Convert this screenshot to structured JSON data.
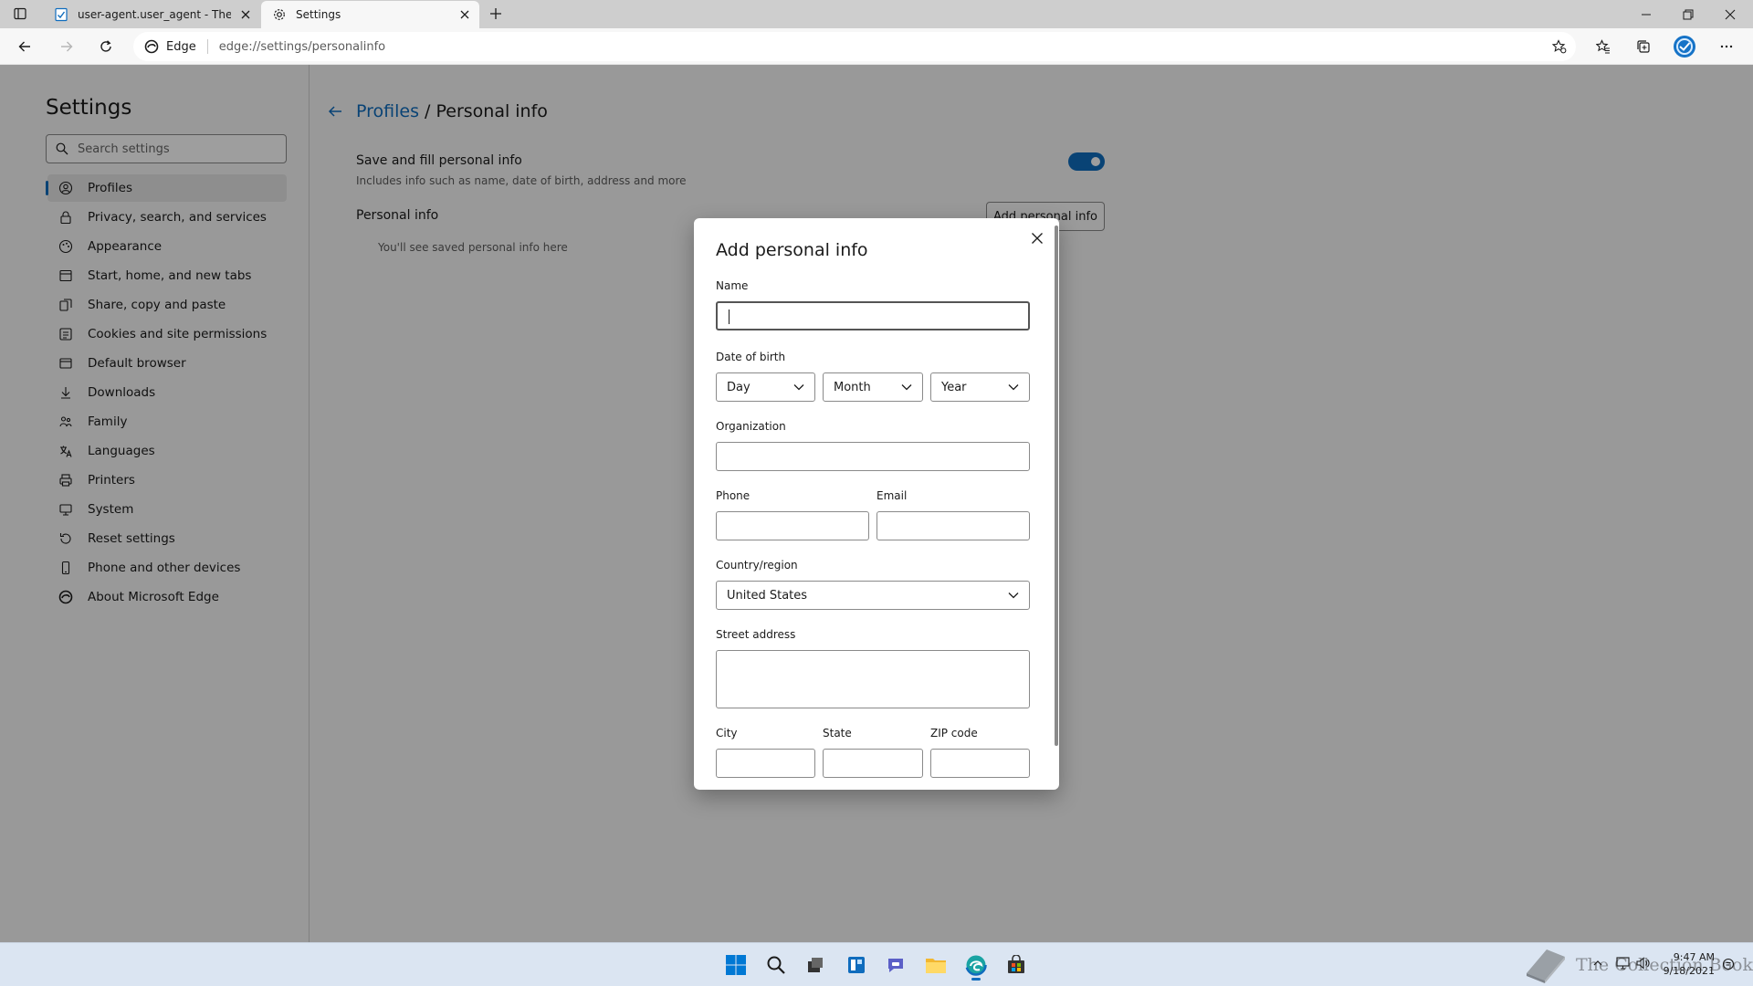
{
  "browser": {
    "tabs": [
      {
        "title": "user-agent.user_agent - The Coll",
        "icon": "document-icon"
      },
      {
        "title": "Settings",
        "icon": "gear-icon"
      }
    ],
    "address": {
      "site": "Edge",
      "url": "edge://settings/personalinfo"
    }
  },
  "sidebar": {
    "title": "Settings",
    "search_placeholder": "Search settings",
    "items": [
      {
        "label": "Profiles",
        "icon": "profile-icon"
      },
      {
        "label": "Privacy, search, and services",
        "icon": "lock-icon"
      },
      {
        "label": "Appearance",
        "icon": "appearance-icon"
      },
      {
        "label": "Start, home, and new tabs",
        "icon": "home-icon"
      },
      {
        "label": "Share, copy and paste",
        "icon": "share-icon"
      },
      {
        "label": "Cookies and site permissions",
        "icon": "cookie-icon"
      },
      {
        "label": "Default browser",
        "icon": "browser-icon"
      },
      {
        "label": "Downloads",
        "icon": "download-icon"
      },
      {
        "label": "Family",
        "icon": "family-icon"
      },
      {
        "label": "Languages",
        "icon": "language-icon"
      },
      {
        "label": "Printers",
        "icon": "printer-icon"
      },
      {
        "label": "System",
        "icon": "system-icon"
      },
      {
        "label": "Reset settings",
        "icon": "reset-icon"
      },
      {
        "label": "Phone and other devices",
        "icon": "phone-icon"
      },
      {
        "label": "About Microsoft Edge",
        "icon": "edge-icon"
      }
    ]
  },
  "main": {
    "breadcrumb_link": "Profiles",
    "breadcrumb_sep": " / ",
    "breadcrumb_current": "Personal info",
    "fill_title": "Save and fill personal info",
    "fill_desc": "Includes info such as name, date of birth, address and more",
    "fill_enabled": true,
    "section_title": "Personal info",
    "add_button": "Add personal info",
    "empty_note": "You'll see saved personal info here"
  },
  "dialog": {
    "title": "Add personal info",
    "name_label": "Name",
    "name_value": "",
    "dob_label": "Date of birth",
    "day": "Day",
    "month": "Month",
    "year": "Year",
    "org_label": "Organization",
    "org_value": "",
    "phone_label": "Phone",
    "phone_value": "",
    "email_label": "Email",
    "email_value": "",
    "country_label": "Country/region",
    "country_value": "United States",
    "street_label": "Street address",
    "street_value": "",
    "city_label": "City",
    "city_value": "",
    "state_label": "State",
    "state_value": "",
    "zip_label": "ZIP code",
    "zip_value": ""
  },
  "taskbar": {
    "time": "9:47 AM",
    "date": "9/18/2021",
    "watermark": "The Collection Book"
  },
  "colors": {
    "accent": "#0f6cbd",
    "overlay": "rgba(0,0,0,0.38)"
  }
}
